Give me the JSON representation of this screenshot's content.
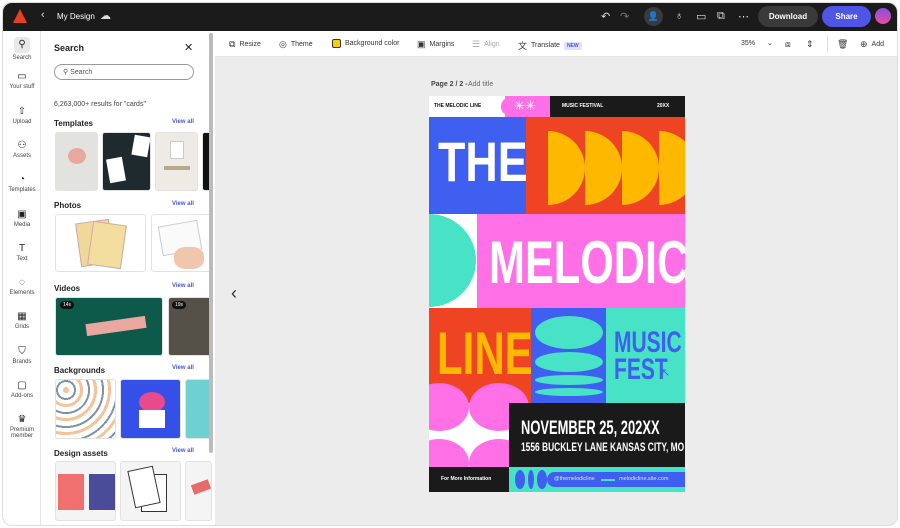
{
  "topbar": {
    "title": "My Design",
    "download": "Download",
    "share": "Share"
  },
  "toolbar": {
    "resize": "Resize",
    "theme": "Theme",
    "background_color": "Background color",
    "margins": "Margins",
    "align": "Align",
    "translate": "Translate",
    "new_badge": "NEW",
    "zoom": "35%",
    "add": "Add"
  },
  "rail": [
    {
      "label": "Search",
      "icon": "search-icon"
    },
    {
      "label": "Your stuff",
      "icon": "folder-icon"
    },
    {
      "label": "Upload",
      "icon": "upload-icon"
    },
    {
      "label": "Assets",
      "icon": "assets-icon"
    },
    {
      "label": "Templates",
      "icon": "templates-icon"
    },
    {
      "label": "Media",
      "icon": "media-icon"
    },
    {
      "label": "Text",
      "icon": "text-icon"
    },
    {
      "label": "Elements",
      "icon": "elements-icon"
    },
    {
      "label": "Grids",
      "icon": "grids-icon"
    },
    {
      "label": "Brands",
      "icon": "brands-icon"
    },
    {
      "label": "Add-ons",
      "icon": "addons-icon"
    },
    {
      "label": "Premium member",
      "icon": "crown-icon"
    }
  ],
  "panel": {
    "title": "Search",
    "search_placeholder": "Search",
    "results": "6,263,000+ results for \"cards\"",
    "view_all": "View all",
    "sections": [
      "Templates",
      "Photos",
      "Videos",
      "Backgrounds",
      "Design assets"
    ],
    "video_durations": [
      "14s",
      "19s"
    ]
  },
  "canvas": {
    "page_label": "Page 2 / 2 -",
    "add_title": "Add title"
  },
  "poster": {
    "brand": "THE MELODIC LINE",
    "festival": "MUSIC FESTIVAL",
    "year": "20XX",
    "the": "THE",
    "melodic": "MELODIC",
    "line": "LINE",
    "music": "MUSIC",
    "fest": "FEST",
    "date": "NOVEMBER 25, 202XX",
    "address": "1556 BUCKLEY LANE KANSAS CITY, MO",
    "info": "For More Information",
    "handle": "@themelodicline",
    "site": "melodicline.site.com"
  },
  "colors": {
    "accent": "#4f56e6",
    "blue": "#3f5ff0",
    "red": "#ee4423",
    "yellow": "#ffb800",
    "pink": "#ff6fe6",
    "teal": "#48e3c6",
    "black": "#1a1a1a"
  }
}
